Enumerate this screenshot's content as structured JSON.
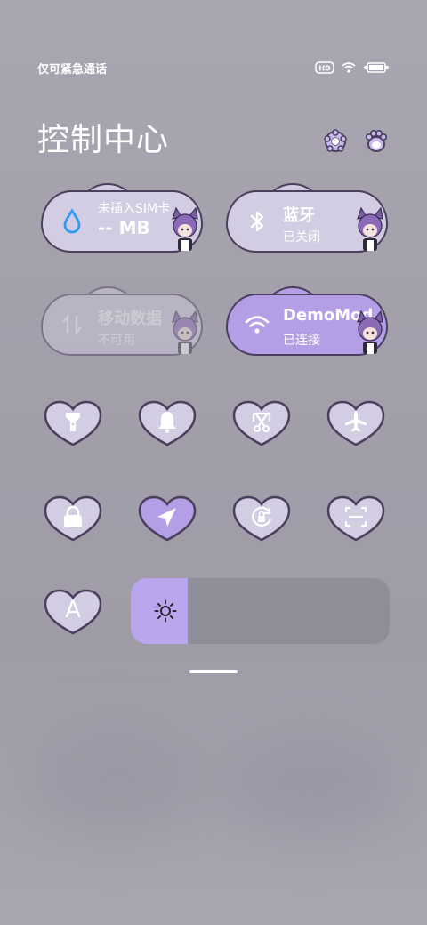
{
  "status_bar": {
    "carrier": "仅可紧急通话",
    "icons": [
      "hd-icon",
      "wifi-icon",
      "battery-icon"
    ]
  },
  "header": {
    "title": "控制中心",
    "icons": [
      "gear-icon",
      "paw-icon"
    ]
  },
  "tiles": [
    {
      "name": "mobile-data-usage",
      "icon": "water-drop-icon",
      "title": "未插入SIM卡",
      "subtitle": "-- MB",
      "state": "inactive"
    },
    {
      "name": "bluetooth",
      "icon": "bluetooth-icon",
      "title": "蓝牙",
      "subtitle": "已关闭",
      "state": "off"
    },
    {
      "name": "mobile-data",
      "icon": "data-arrows-icon",
      "title": "移动数据",
      "subtitle": "不可用",
      "state": "disabled"
    },
    {
      "name": "wifi",
      "icon": "wifi-icon",
      "title": "DemoMod",
      "subtitle": "已连接",
      "state": "on"
    }
  ],
  "toggles_row1": [
    {
      "name": "flashlight",
      "icon": "flashlight-icon",
      "active": false
    },
    {
      "name": "ringer",
      "icon": "bell-icon",
      "active": false
    },
    {
      "name": "screenshot",
      "icon": "scissors-icon",
      "active": false
    },
    {
      "name": "airplane-mode",
      "icon": "airplane-icon",
      "active": false
    }
  ],
  "toggles_row2": [
    {
      "name": "lock-screen",
      "icon": "lock-icon",
      "active": false
    },
    {
      "name": "location",
      "icon": "location-arrow-icon",
      "active": true
    },
    {
      "name": "auto-rotate",
      "icon": "rotate-lock-icon",
      "active": false
    },
    {
      "name": "scanner",
      "icon": "scan-icon",
      "active": false
    }
  ],
  "toggles_row3": [
    {
      "name": "auto-brightness",
      "icon": "letter-a-icon",
      "label": "A",
      "active": false
    }
  ],
  "brightness": {
    "level": 0.22,
    "icon": "sun-icon"
  },
  "colors": {
    "accent": "#b49ee6",
    "tile_light": "#d3cde3",
    "outline": "#4a3f5c",
    "wifi_blue": "#2f9bf0"
  }
}
